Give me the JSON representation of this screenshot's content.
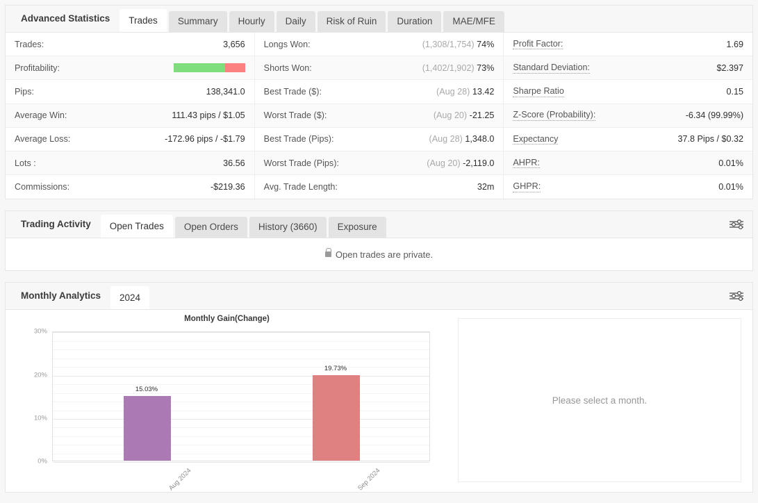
{
  "advanced_statistics": {
    "title": "Advanced Statistics",
    "tabs": [
      {
        "label": "Trades",
        "active": true
      },
      {
        "label": "Summary",
        "active": false
      },
      {
        "label": "Hourly",
        "active": false
      },
      {
        "label": "Daily",
        "active": false
      },
      {
        "label": "Risk of Ruin",
        "active": false
      },
      {
        "label": "Duration",
        "active": false
      },
      {
        "label": "MAE/MFE",
        "active": false
      }
    ],
    "columns": [
      {
        "rows": [
          {
            "label": "Trades:",
            "value": "3,656",
            "type": "text",
            "hint": false
          },
          {
            "label": "Profitability:",
            "value": "",
            "type": "bar",
            "hint": false,
            "bar": {
              "win_pct": 72,
              "lose_pct": 28,
              "win_color": "#7ede7c",
              "lose_color": "#fb8080"
            }
          },
          {
            "label": "Pips:",
            "value": "138,341.0",
            "type": "text",
            "hint": false
          },
          {
            "label": "Average Win:",
            "value": "111.43 pips / $1.05",
            "type": "text",
            "hint": false
          },
          {
            "label": "Average Loss:",
            "value": "-172.96 pips / -$1.79",
            "type": "text",
            "hint": false
          },
          {
            "label": "Lots :",
            "value": "36.56",
            "type": "text",
            "hint": false
          },
          {
            "label": "Commissions:",
            "value": "-$219.36",
            "type": "text",
            "hint": false
          }
        ]
      },
      {
        "rows": [
          {
            "label": "Longs Won:",
            "muted": "(1,308/1,754)",
            "value": "74%",
            "type": "muted",
            "hint": false
          },
          {
            "label": "Shorts Won:",
            "muted": "(1,402/1,902)",
            "value": "73%",
            "type": "muted",
            "hint": false
          },
          {
            "label": "Best Trade ($):",
            "muted": "(Aug 28)",
            "value": "13.42",
            "type": "muted",
            "hint": false
          },
          {
            "label": "Worst Trade ($):",
            "muted": "(Aug 20)",
            "value": "-21.25",
            "type": "muted",
            "hint": false
          },
          {
            "label": "Best Trade (Pips):",
            "muted": "(Aug 28)",
            "value": "1,348.0",
            "type": "muted",
            "hint": false
          },
          {
            "label": "Worst Trade (Pips):",
            "muted": "(Aug 20)",
            "value": "-2,119.0",
            "type": "muted",
            "hint": false
          },
          {
            "label": "Avg. Trade Length:",
            "muted": "",
            "value": "32m",
            "type": "muted",
            "hint": false
          }
        ]
      },
      {
        "rows": [
          {
            "label": "Profit Factor:",
            "value": "1.69",
            "type": "text",
            "hint": true
          },
          {
            "label": "Standard Deviation:",
            "value": "$2.397",
            "type": "text",
            "hint": true
          },
          {
            "label": "Sharpe Ratio",
            "value": "0.15",
            "type": "text",
            "hint": true
          },
          {
            "label": "Z-Score (Probability):",
            "value": "-6.34 (99.99%)",
            "type": "text",
            "hint": true
          },
          {
            "label": "Expectancy",
            "value": "37.8 Pips / $0.32",
            "type": "text",
            "hint": true
          },
          {
            "label": "AHPR:",
            "value": "0.01%",
            "type": "text",
            "hint": true
          },
          {
            "label": "GHPR:",
            "value": "0.01%",
            "type": "text",
            "hint": true
          }
        ]
      }
    ]
  },
  "trading_activity": {
    "title": "Trading Activity",
    "tabs": [
      {
        "label": "Open Trades",
        "active": true
      },
      {
        "label": "Open Orders",
        "active": false
      },
      {
        "label": "History (3660)",
        "active": false
      },
      {
        "label": "Exposure",
        "active": false
      }
    ],
    "message": "Open trades are private."
  },
  "monthly_analytics": {
    "title": "Monthly Analytics",
    "tabs": [
      {
        "label": "2024",
        "active": true
      }
    ],
    "detail_placeholder": "Please select a month."
  },
  "chart_data": {
    "type": "bar",
    "title": "Monthly Gain(Change)",
    "categories": [
      "Aug 2024",
      "Sep 2024"
    ],
    "values": [
      15.03,
      19.73
    ],
    "data_labels": [
      "15.03%",
      "19.73%"
    ],
    "colors": [
      "#ab79b3",
      "#df8181"
    ],
    "xlabel": "",
    "ylabel": "",
    "ylim": [
      0,
      30
    ],
    "ytick_values": [
      0,
      10,
      20,
      30
    ],
    "ytick_labels": [
      "0%",
      "10%",
      "20%",
      "30%"
    ],
    "minor_tick_step": 2,
    "grid": true,
    "legend": false
  }
}
